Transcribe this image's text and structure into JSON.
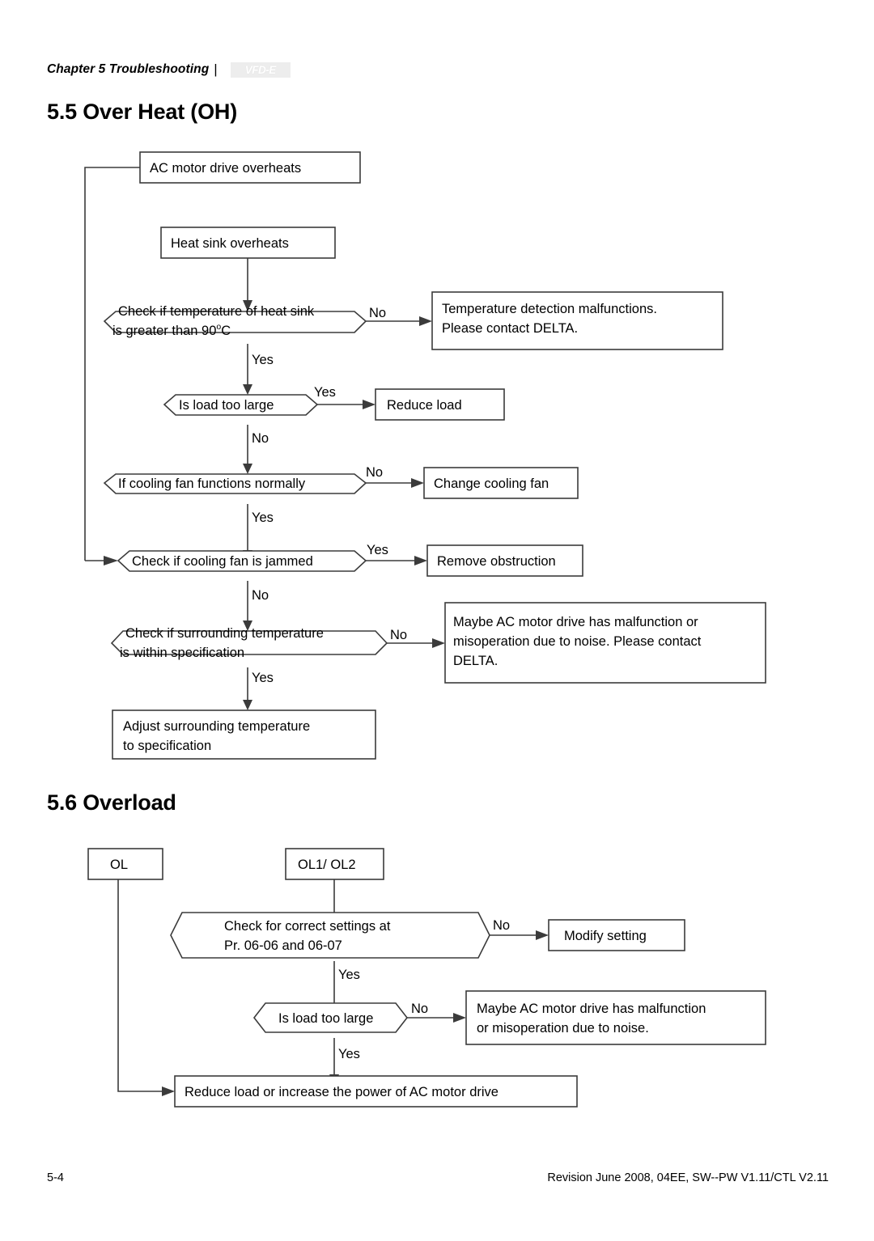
{
  "header": {
    "chapter": "Chapter 5  Troubleshooting",
    "separator": "|",
    "logo_text": "VFD-E"
  },
  "sections": {
    "over_heat": {
      "heading": "5.5 Over Heat (OH)"
    },
    "overload": {
      "heading": "5.6 Overload"
    }
  },
  "flowchart_oh": {
    "start": "AC motor drive overheats",
    "heat_sink": "Heat sink overheats",
    "check_temp_line1": "Check if temperature of heat sink",
    "check_temp_line2_pre": "is greater than 90",
    "check_temp_deg": "o",
    "check_temp_line2_post": "C",
    "temp_no": "No",
    "temp_yes": "Yes",
    "temp_result_line1": "Temperature detection malfunctions.",
    "temp_result_line2": "Please contact  DELTA.",
    "load_question": "Is load too large",
    "load_yes": "Yes",
    "load_no": "No",
    "load_result": "Reduce load",
    "fan_question": "If cooling fan functions normally",
    "fan_no": "No",
    "fan_yes": "Yes",
    "fan_result": "Change cooling fan",
    "jam_question": "Check if cooling fan is jammed",
    "jam_yes": "Yes",
    "jam_no": "No",
    "jam_result": "Remove obstruction",
    "surround_line1": "Check if surrounding temperature",
    "surround_line2": "is within specification",
    "surround_no": "No",
    "surround_yes": "Yes",
    "surround_result_line1": "Maybe AC motor drive has malfunction or",
    "surround_result_line2": "misoperation due to noise. Please contact",
    "surround_result_line3": "DELTA.",
    "adjust_line1": "Adjust surrounding temperature",
    "adjust_line2": "to specification"
  },
  "flowchart_ol": {
    "ol_start": "OL",
    "ol12_start": "OL1/ OL2",
    "settings_line1": "Check for correct settings at",
    "settings_line2": "Pr. 06-06 and 06-07",
    "settings_no": "No",
    "settings_yes": "Yes",
    "settings_result": "Modify setting",
    "load_question": "Is load too large",
    "load_no": "No",
    "load_yes": "Yes",
    "load_result_line1": "Maybe AC motor drive has malfunction",
    "load_result_line2": "or misoperation due to noise.",
    "final_result": "Reduce load or increase the power of AC motor drive"
  },
  "footer": {
    "page_number": "5-4",
    "revision": "Revision June 2008, 04EE, SW--PW V1.11/CTL V2.11"
  }
}
